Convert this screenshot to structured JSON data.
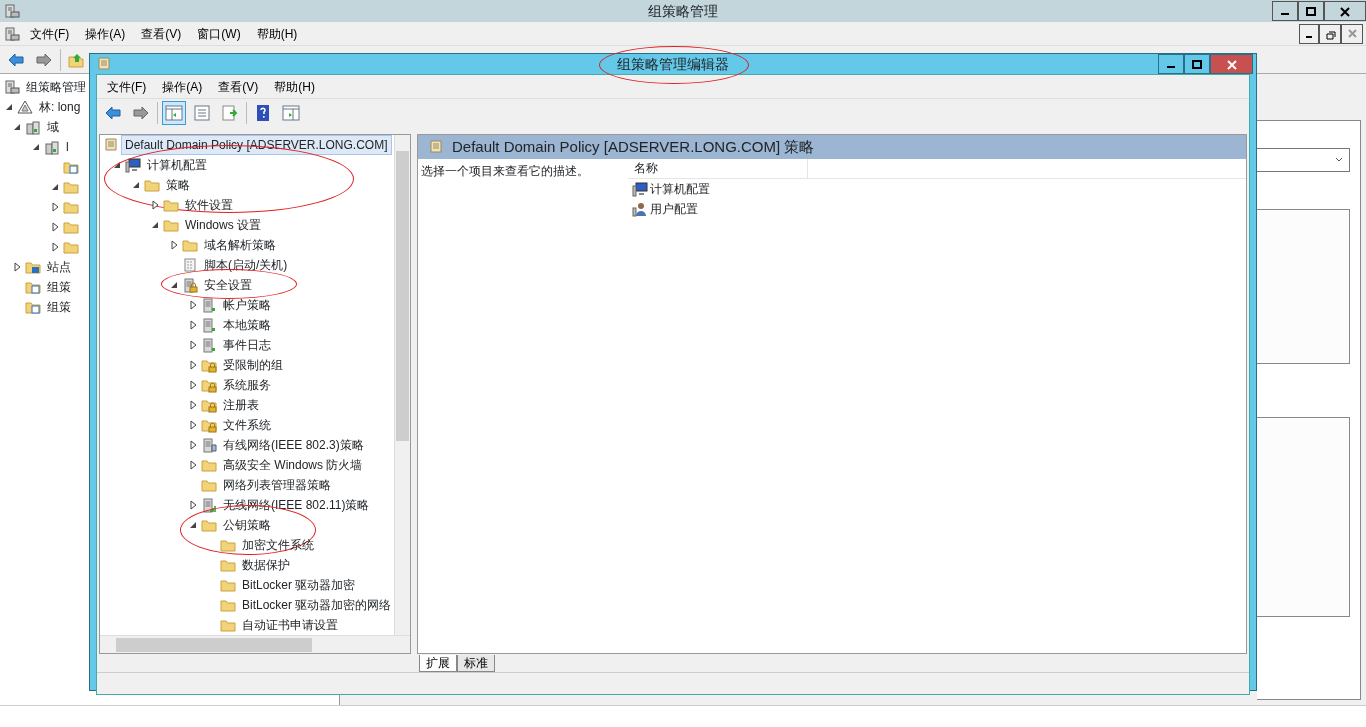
{
  "main_window": {
    "title": "组策略管理",
    "menu": [
      "文件(F)",
      "操作(A)",
      "查看(V)",
      "窗口(W)",
      "帮助(H)"
    ],
    "toolbar": [
      {
        "kind": "back"
      },
      {
        "kind": "forward"
      },
      {
        "kind": "up"
      }
    ],
    "tree": [
      {
        "label": "组策略管理",
        "kind": "gpm",
        "selected": false
      },
      {
        "label": "林: long",
        "kind": "forest",
        "expanded": true,
        "selected": false,
        "children": [
          {
            "label": "域",
            "kind": "domain",
            "expanded": true,
            "selected": false,
            "children": [
              {
                "label": "l",
                "kind": "domain",
                "expanded": true,
                "selected": false,
                "children": [
                  {
                    "kind": "gpo",
                    "selected": false
                  },
                  {
                    "kind": "folder",
                    "expanded": true,
                    "selected": false
                  },
                  {
                    "kind": "folder",
                    "expanded": false,
                    "selected": false
                  },
                  {
                    "kind": "folder",
                    "expanded": false,
                    "selected": false
                  },
                  {
                    "kind": "folder",
                    "expanded": false,
                    "selected": false
                  }
                ]
              }
            ]
          },
          {
            "label": "站点",
            "kind": "site",
            "expanded": false,
            "selected": false
          },
          {
            "label": "组策",
            "kind": "gpo",
            "selected": false
          },
          {
            "label": "组策",
            "kind": "gpo",
            "selected": false
          }
        ]
      }
    ]
  },
  "editor_window": {
    "title": "组策略管理编辑器",
    "title_circled": true,
    "menu": [
      "文件(F)",
      "操作(A)",
      "查看(V)",
      "帮助(H)"
    ],
    "toolbar": [
      {
        "kind": "back",
        "selected": false
      },
      {
        "kind": "forward",
        "selected": false
      },
      {
        "kind": "tree-toggle",
        "selected": true
      },
      {
        "kind": "list",
        "selected": false
      },
      {
        "kind": "export",
        "selected": false
      },
      {
        "kind": "help",
        "selected": false
      },
      {
        "kind": "pane",
        "selected": false
      }
    ],
    "tree": [
      {
        "label": "Default Domain Policy [ADSERVER.LONG.COM]",
        "kind": "scroll",
        "selected": true,
        "children": [
          {
            "label": "计算机配置",
            "kind": "computer",
            "expanded": true,
            "selected": false,
            "circled": true,
            "children": [
              {
                "label": "策略",
                "kind": "folder",
                "expanded": true,
                "selected": false,
                "children": [
                  {
                    "label": "软件设置",
                    "kind": "folder",
                    "expanded": false,
                    "selected": false
                  },
                  {
                    "label": "Windows 设置",
                    "kind": "folder",
                    "expanded": true,
                    "selected": false,
                    "children": [
                      {
                        "label": "域名解析策略",
                        "kind": "folder",
                        "expanded": false,
                        "selected": false
                      },
                      {
                        "label": "脚本(启动/关机)",
                        "kind": "script",
                        "selected": false
                      },
                      {
                        "label": "安全设置",
                        "kind": "server-lock",
                        "expanded": true,
                        "selected": false,
                        "circled": true,
                        "children": [
                          {
                            "label": "帐户策略",
                            "kind": "server",
                            "expanded": false,
                            "selected": false
                          },
                          {
                            "label": "本地策略",
                            "kind": "server",
                            "expanded": false,
                            "selected": false
                          },
                          {
                            "label": "事件日志",
                            "kind": "server",
                            "expanded": false,
                            "selected": false
                          },
                          {
                            "label": "受限制的组",
                            "kind": "folder-lock",
                            "expanded": false,
                            "selected": false
                          },
                          {
                            "label": "系统服务",
                            "kind": "folder-lock",
                            "expanded": false,
                            "selected": false
                          },
                          {
                            "label": "注册表",
                            "kind": "folder-lock",
                            "expanded": false,
                            "selected": false
                          },
                          {
                            "label": "文件系统",
                            "kind": "folder-lock",
                            "expanded": false,
                            "selected": false
                          },
                          {
                            "label": "有线网络(IEEE 802.3)策略",
                            "kind": "network",
                            "expanded": false,
                            "selected": false
                          },
                          {
                            "label": "高级安全 Windows 防火墙",
                            "kind": "folder",
                            "expanded": false,
                            "selected": false
                          },
                          {
                            "label": "网络列表管理器策略",
                            "kind": "folder",
                            "selected": false
                          },
                          {
                            "label": "无线网络(IEEE 802.11)策略",
                            "kind": "wireless",
                            "expanded": false,
                            "selected": false
                          },
                          {
                            "label": "公钥策略",
                            "kind": "folder",
                            "expanded": true,
                            "selected": false,
                            "circled": true,
                            "children": [
                              {
                                "label": "加密文件系统",
                                "kind": "folder",
                                "selected": false
                              },
                              {
                                "label": "数据保护",
                                "kind": "folder",
                                "selected": false
                              },
                              {
                                "label": "BitLocker 驱动器加密",
                                "kind": "folder",
                                "selected": false
                              },
                              {
                                "label": "BitLocker 驱动器加密的网络",
                                "kind": "folder",
                                "selected": false
                              },
                              {
                                "label": "自动证书申请设置",
                                "kind": "folder",
                                "selected": false
                              }
                            ]
                          }
                        ]
                      }
                    ]
                  }
                ]
              }
            ]
          }
        ]
      }
    ],
    "details": {
      "header": "Default Domain Policy [ADSERVER.LONG.COM] 策略",
      "description": "选择一个项目来查看它的描述。",
      "columns": [
        "名称"
      ],
      "items": [
        {
          "label": "计算机配置",
          "kind": "computer"
        },
        {
          "label": "用户配置",
          "kind": "user"
        }
      ]
    },
    "tabs": [
      {
        "label": "扩展",
        "selected": true
      },
      {
        "label": "标准",
        "selected": false
      }
    ]
  }
}
